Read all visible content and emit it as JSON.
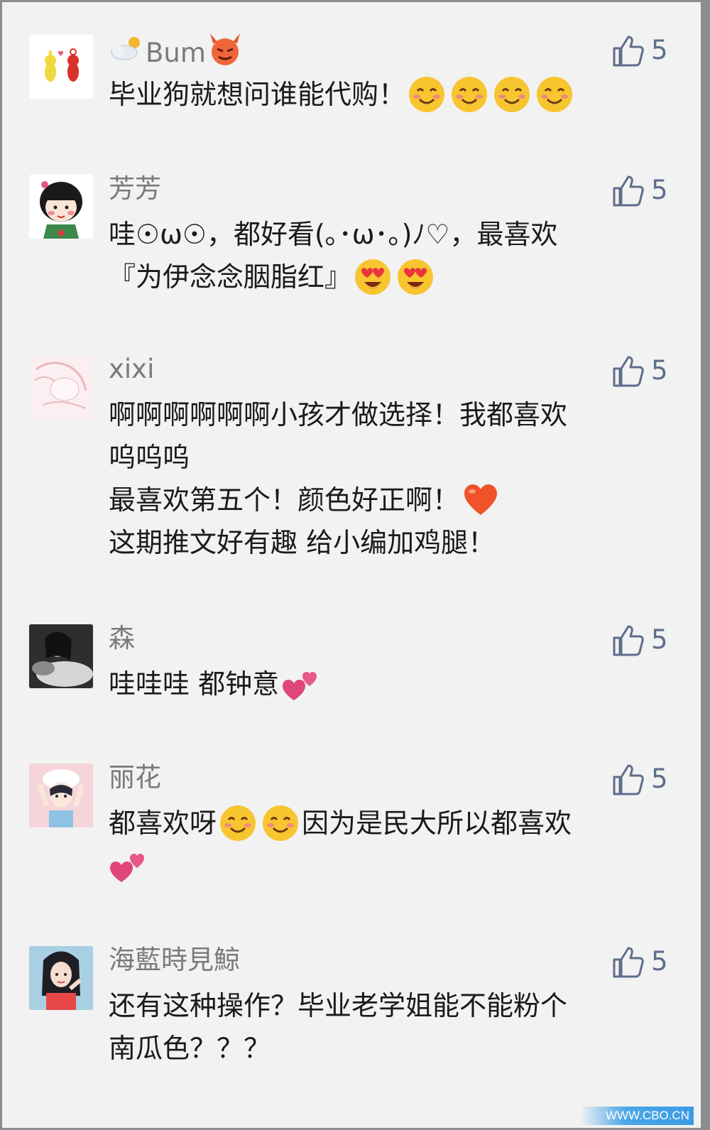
{
  "comments": [
    {
      "name": "Bum",
      "likes": "5",
      "lines": [
        "毕业狗就想问谁能代购！"
      ],
      "emoji": [
        "smile-emoji",
        "smile-emoji",
        "smile-emoji",
        "smile-emoji"
      ]
    },
    {
      "name": "芳芳",
      "likes": "5",
      "lines": [
        "哇☉ω☉，都好看(｡･ω･｡)ﾉ♡，最喜欢",
        "『为伊念念胭脂红』"
      ],
      "emoji": [
        "heart-eyes-emoji",
        "heart-eyes-emoji"
      ]
    },
    {
      "name": "xixi",
      "likes": "5",
      "lines": [
        "啊啊啊啊啊啊小孩才做选择！我都喜欢",
        "呜呜呜",
        "最喜欢第五个！颜色好正啊！",
        "这期推文好有趣 给小编加鸡腿！"
      ],
      "emoji": [
        "red-heart-emoji"
      ]
    },
    {
      "name": "森",
      "likes": "5",
      "lines": [
        "哇哇哇 都钟意"
      ],
      "emoji": [
        "two-hearts-emoji"
      ]
    },
    {
      "name": "丽花",
      "likes": "5",
      "lines": [
        "都喜欢呀",
        "因为是民大所以都喜欢"
      ],
      "emoji": [
        "smile-emoji",
        "smile-emoji",
        "two-hearts-emoji"
      ]
    },
    {
      "name": "海藍時見鯨",
      "likes": "5",
      "lines": [
        "还有这种操作？毕业老学姐能不能粉个",
        "南瓜色？？？"
      ],
      "emoji": []
    }
  ],
  "watermark": "WWW.CBO.CN",
  "colors": {
    "background": "#f2f2f2",
    "name_text": "#7a7a7a",
    "body_text": "#1a1a1a",
    "like_icon": "#5f6d8c"
  }
}
